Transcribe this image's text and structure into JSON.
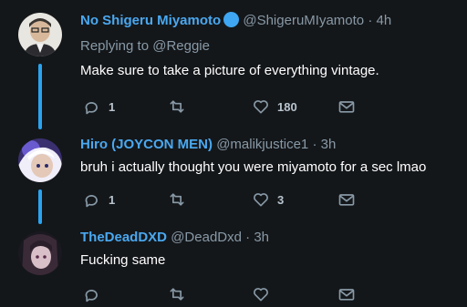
{
  "tweets": [
    {
      "display_name": "No Shigeru Miyamoto",
      "handle": "@ShigeruMIyamoto",
      "time": "4h",
      "replying_prefix": "Replying to",
      "replying_to": "@Reggie",
      "text": "Make sure to take a picture of everything vintage.",
      "reply_count": "1",
      "retweet_count": "",
      "like_count": "180",
      "verified": true
    },
    {
      "display_name": "Hiro (JOYCON MEN)",
      "handle": "@malikjustice1",
      "time": "3h",
      "text": "bruh i actually thought you were miyamoto for a sec lmao",
      "reply_count": "1",
      "retweet_count": "",
      "like_count": "3"
    },
    {
      "display_name": "TheDeadDXD",
      "handle": "@DeadDxd",
      "time": "3h",
      "text": "Fucking same",
      "reply_count": "",
      "retweet_count": "",
      "like_count": ""
    }
  ],
  "separator": "·",
  "colors": {
    "background": "#14171a",
    "name": "#4aa8f0",
    "muted": "#8899a6",
    "thread": "#2aa3ef"
  },
  "icons": [
    "reply-icon",
    "retweet-icon",
    "like-icon",
    "message-icon"
  ]
}
